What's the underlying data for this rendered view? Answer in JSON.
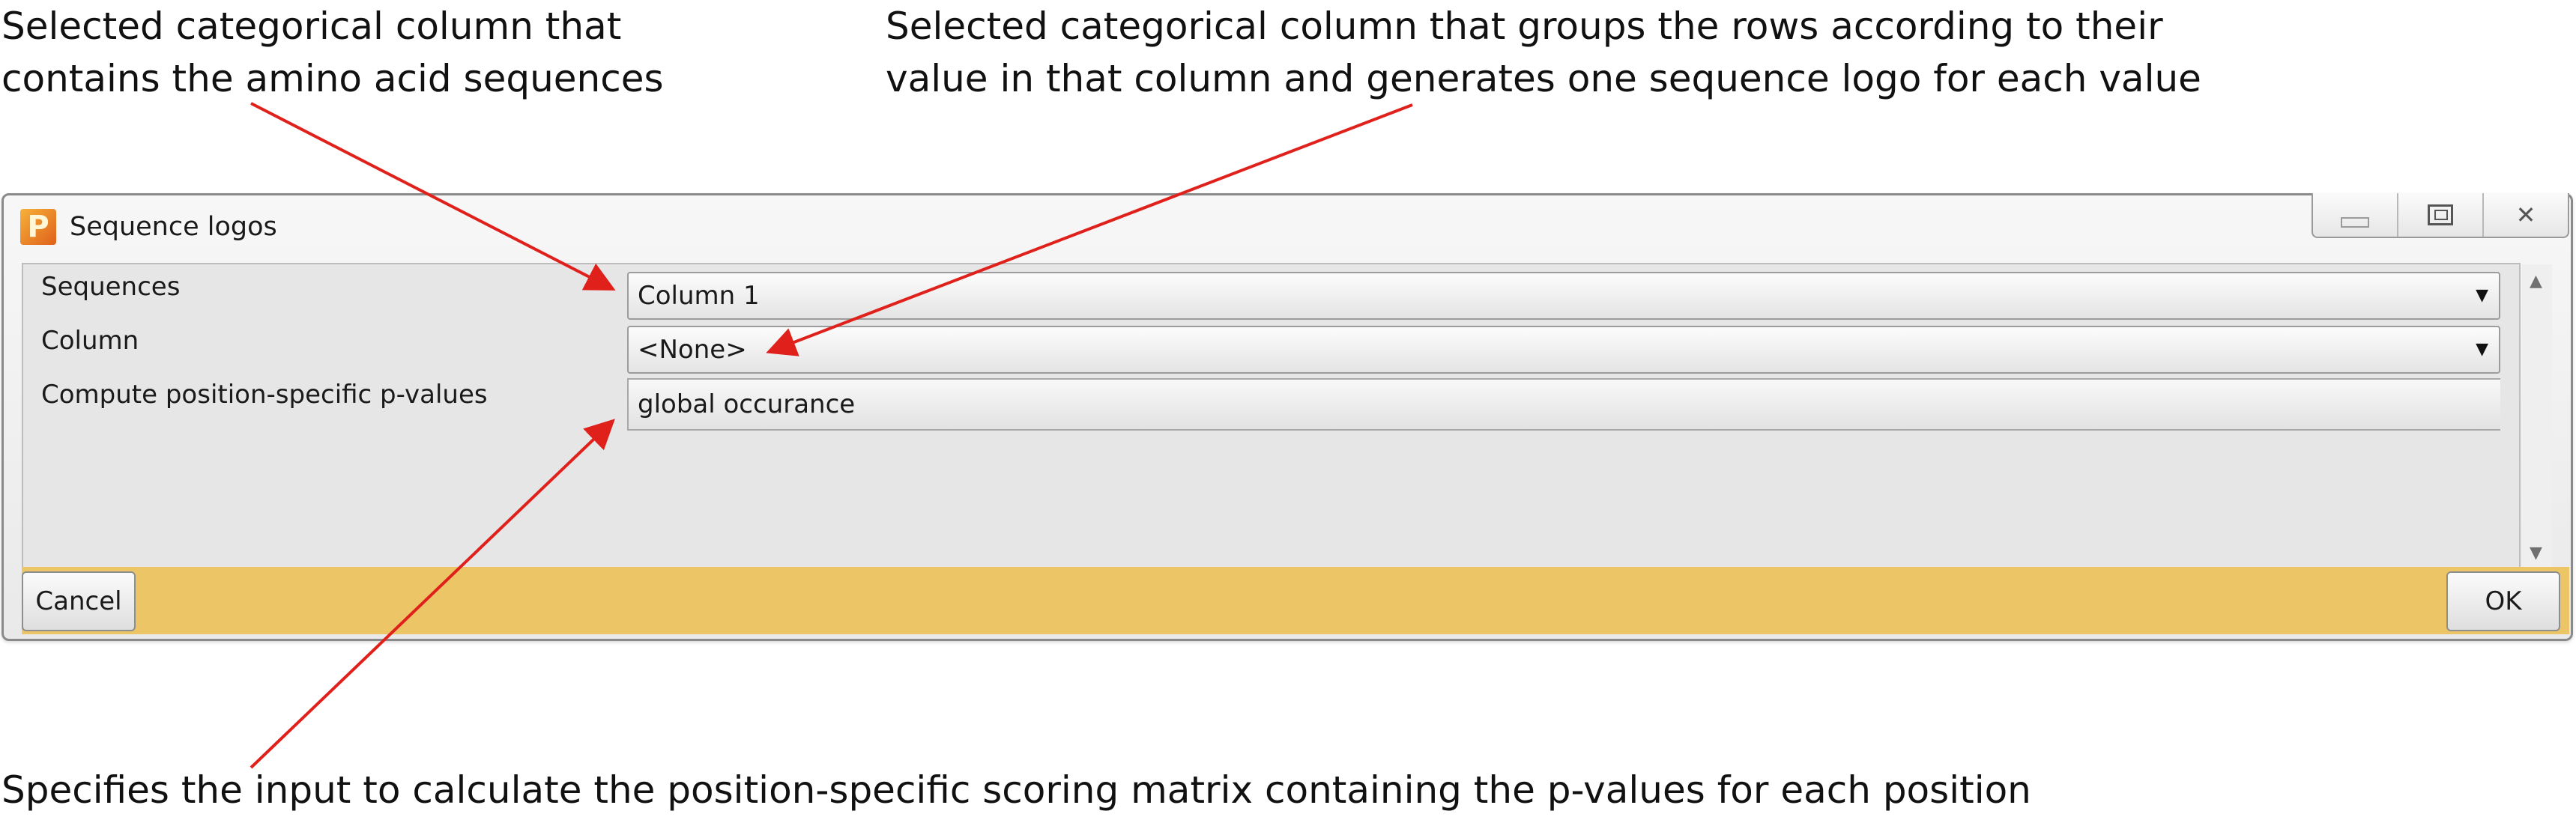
{
  "annotations": {
    "sequences_note": "Selected categorical column that\ncontains the amino acid sequences",
    "column_note": "Selected categorical column that groups the rows according to their\nvalue in that column and generates one sequence logo for each value",
    "pvalues_note": "Specifies the input to calculate the position-specific scoring matrix containing the p-values for each position"
  },
  "window": {
    "title": "Sequence logos",
    "icon": "app-p-icon"
  },
  "form": {
    "sequences_label": "Sequences",
    "sequences_value": "Column 1",
    "column_label": "Column",
    "column_value": "<None>",
    "pvalues_label": "Compute position-specific p-values",
    "pvalues_value": "global occurance"
  },
  "buttons": {
    "cancel": "Cancel",
    "ok": "OK"
  },
  "colors": {
    "footer": "#ecc566",
    "annotation_arrow": "#e0201b"
  }
}
